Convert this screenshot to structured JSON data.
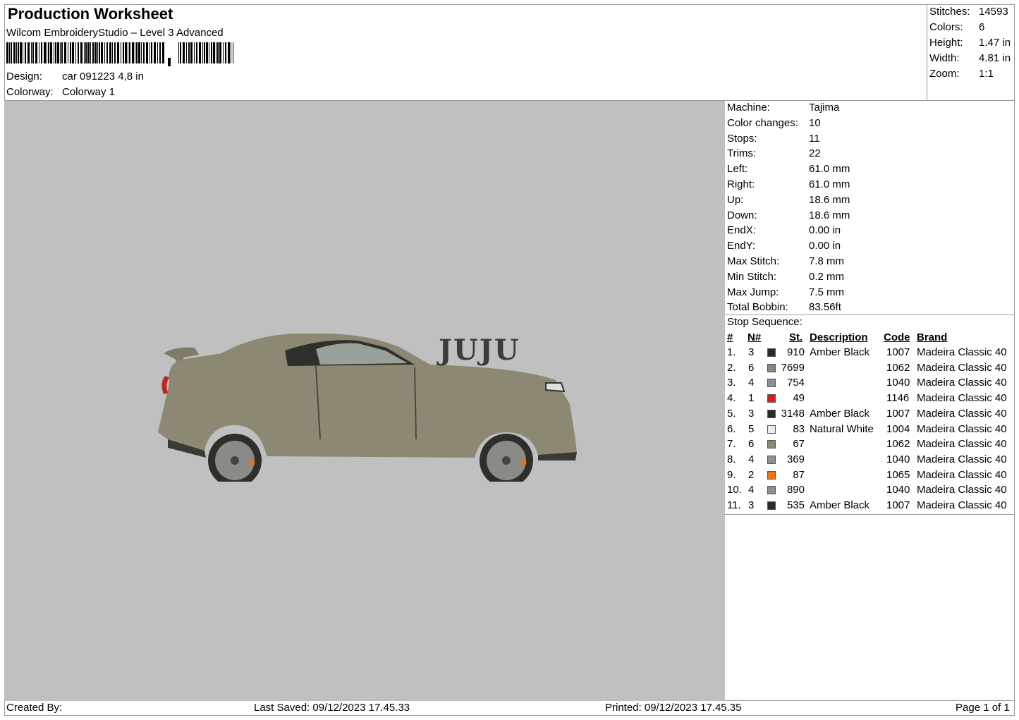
{
  "header": {
    "title": "Production Worksheet",
    "subtitle": "Wilcom EmbroideryStudio – Level 3 Advanced",
    "design_label": "Design:",
    "design_value": "car 091223 4,8 in",
    "colorway_label": "Colorway:",
    "colorway_value": "Colorway 1"
  },
  "summary": [
    {
      "label": "Stitches:",
      "value": "14593"
    },
    {
      "label": "Colors:",
      "value": "6"
    },
    {
      "label": "Height:",
      "value": "1.47 in"
    },
    {
      "label": "Width:",
      "value": "4.81 in"
    },
    {
      "label": "Zoom:",
      "value": "1:1"
    }
  ],
  "machine_info": [
    {
      "label": "Machine:",
      "value": "Tajima"
    },
    {
      "label": "Color changes:",
      "value": "10"
    },
    {
      "label": "Stops:",
      "value": "11"
    },
    {
      "label": "Trims:",
      "value": "22"
    },
    {
      "label": "Left:",
      "value": "61.0 mm"
    },
    {
      "label": "Right:",
      "value": "61.0 mm"
    },
    {
      "label": "Up:",
      "value": "18.6 mm"
    },
    {
      "label": "Down:",
      "value": "18.6 mm"
    },
    {
      "label": "EndX:",
      "value": "0.00 in"
    },
    {
      "label": "EndY:",
      "value": "0.00 in"
    },
    {
      "label": "Max Stitch:",
      "value": "7.8 mm"
    },
    {
      "label": "Min Stitch:",
      "value": "0.2 mm"
    },
    {
      "label": "Max Jump:",
      "value": "7.5 mm"
    },
    {
      "label": "Total Bobbin:",
      "value": "83.56ft"
    }
  ],
  "stop_sequence": {
    "title": "Stop Sequence:",
    "headers": {
      "num": "#",
      "n": "N#",
      "st": "St.",
      "desc": "Description",
      "code": "Code",
      "brand": "Brand"
    },
    "rows": [
      {
        "num": "1.",
        "n": "3",
        "color": "#2a2a2a",
        "st": "910",
        "desc": "Amber Black",
        "code": "1007",
        "brand": "Madeira Classic 40"
      },
      {
        "num": "2.",
        "n": "6",
        "color": "#8c8878",
        "st": "7699",
        "desc": "",
        "code": "1062",
        "brand": "Madeira Classic 40"
      },
      {
        "num": "3.",
        "n": "4",
        "color": "#8f8f8f",
        "st": "754",
        "desc": "",
        "code": "1040",
        "brand": "Madeira Classic 40"
      },
      {
        "num": "4.",
        "n": "1",
        "color": "#d82020",
        "st": "49",
        "desc": "",
        "code": "1146",
        "brand": "Madeira Classic 40"
      },
      {
        "num": "5.",
        "n": "3",
        "color": "#2a2a2a",
        "st": "3148",
        "desc": "Amber Black",
        "code": "1007",
        "brand": "Madeira Classic 40"
      },
      {
        "num": "6.",
        "n": "5",
        "color": "#ececf0",
        "st": "83",
        "desc": "Natural White",
        "code": "1004",
        "brand": "Madeira Classic 40"
      },
      {
        "num": "7.",
        "n": "6",
        "color": "#8c8878",
        "st": "67",
        "desc": "",
        "code": "1062",
        "brand": "Madeira Classic 40"
      },
      {
        "num": "8.",
        "n": "4",
        "color": "#8f8f8f",
        "st": "369",
        "desc": "",
        "code": "1040",
        "brand": "Madeira Classic 40"
      },
      {
        "num": "9.",
        "n": "2",
        "color": "#e8731a",
        "st": "87",
        "desc": "",
        "code": "1065",
        "brand": "Madeira Classic 40"
      },
      {
        "num": "10.",
        "n": "4",
        "color": "#8f8f8f",
        "st": "890",
        "desc": "",
        "code": "1040",
        "brand": "Madeira Classic 40"
      },
      {
        "num": "11.",
        "n": "3",
        "color": "#2a2a2a",
        "st": "535",
        "desc": "Amber Black",
        "code": "1007",
        "brand": "Madeira Classic 40"
      }
    ]
  },
  "design_preview": {
    "text": "JUJU",
    "background_color": "#c0c0c0"
  },
  "footer": {
    "created_by": "Created By:",
    "last_saved": "Last Saved: 09/12/2023 17.45.33",
    "printed": "Printed: 09/12/2023 17.45.35",
    "page": "Page 1 of 1"
  }
}
